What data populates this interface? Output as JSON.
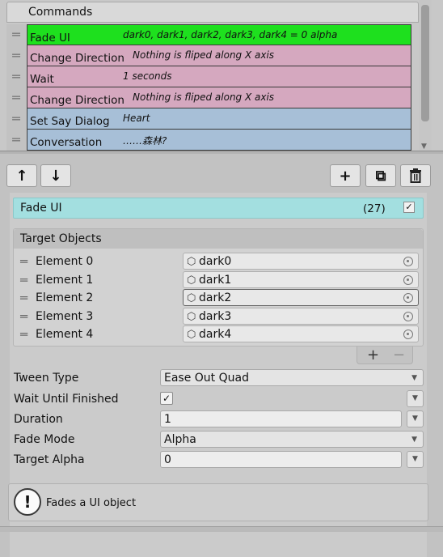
{
  "commands": {
    "header": "Commands",
    "rows": [
      {
        "name": "Fade UI",
        "summary": "dark0, dark1, dark2, dark3, dark4 = 0 alpha",
        "color": "#1ee01e"
      },
      {
        "name": "Change Direction",
        "summary": "Nothing is fliped along X axis",
        "color": "#d5a8bf"
      },
      {
        "name": "Wait",
        "summary": "1 seconds",
        "color": "#d5a8bf"
      },
      {
        "name": "Change Direction",
        "summary": "Nothing is fliped along X axis",
        "color": "#d5a8bf"
      },
      {
        "name": "Set Say Dialog",
        "summary": "Heart",
        "color": "#a7bfd7"
      },
      {
        "name": "Conversation",
        "summary": "……森林?",
        "color": "#a7bfd7"
      }
    ]
  },
  "toolbar": {
    "move_up_icon": "↑",
    "move_down_icon": "↓",
    "add_icon": "+",
    "duplicate_icon": "⧉",
    "delete_icon": "trash"
  },
  "inspector": {
    "title": "Fade UI",
    "count": "(27)",
    "enabled_check": "✓",
    "title_color": "#a3dfe0",
    "target_objects": {
      "header": "Target Objects",
      "elements": [
        {
          "label": "Element 0",
          "value": "dark0"
        },
        {
          "label": "Element 1",
          "value": "dark1"
        },
        {
          "label": "Element 2",
          "value": "dark2"
        },
        {
          "label": "Element 3",
          "value": "dark3"
        },
        {
          "label": "Element 4",
          "value": "dark4"
        }
      ],
      "add": "+",
      "remove": "−"
    },
    "properties": {
      "tween_type_label": "Tween Type",
      "tween_type_value": "Ease Out Quad",
      "wait_label": "Wait Until Finished",
      "wait_check": "✓",
      "duration_label": "Duration",
      "duration_value": "1",
      "fade_mode_label": "Fade Mode",
      "fade_mode_value": "Alpha",
      "target_alpha_label": "Target Alpha",
      "target_alpha_value": "0",
      "dropdown_arrow": "▼"
    }
  },
  "help": {
    "icon": "!",
    "text": "Fades a UI object"
  }
}
